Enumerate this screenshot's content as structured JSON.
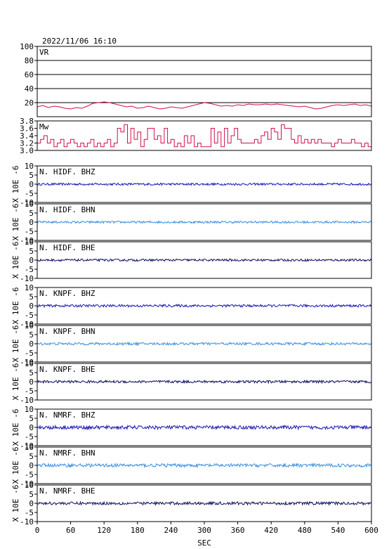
{
  "header": {
    "datetime": "2022/11/06  16:10"
  },
  "colors": {
    "vr": "#d0104a",
    "mw": "#d0104a",
    "grid": "#000000",
    "frame": "#000000"
  },
  "chart_data": {
    "type": "line",
    "x": {
      "label": "SEC",
      "ticks": [
        0,
        60,
        120,
        180,
        240,
        300,
        360,
        420,
        480,
        540,
        600
      ],
      "lim": [
        0,
        600
      ]
    },
    "panels": [
      {
        "kind": "vr",
        "label": "VR",
        "ylim": [
          0,
          100
        ],
        "yticks": [
          20,
          40,
          60,
          80,
          100
        ],
        "grid": true,
        "series": [
          {
            "x": 0,
            "y": 14
          },
          {
            "x": 10,
            "y": 16
          },
          {
            "x": 20,
            "y": 13
          },
          {
            "x": 30,
            "y": 15
          },
          {
            "x": 40,
            "y": 14
          },
          {
            "x": 50,
            "y": 12
          },
          {
            "x": 60,
            "y": 11
          },
          {
            "x": 70,
            "y": 13
          },
          {
            "x": 80,
            "y": 12
          },
          {
            "x": 90,
            "y": 15
          },
          {
            "x": 100,
            "y": 19
          },
          {
            "x": 110,
            "y": 20
          },
          {
            "x": 120,
            "y": 21
          },
          {
            "x": 130,
            "y": 20
          },
          {
            "x": 140,
            "y": 18
          },
          {
            "x": 150,
            "y": 16
          },
          {
            "x": 160,
            "y": 14
          },
          {
            "x": 170,
            "y": 15
          },
          {
            "x": 180,
            "y": 12
          },
          {
            "x": 190,
            "y": 13
          },
          {
            "x": 200,
            "y": 15
          },
          {
            "x": 210,
            "y": 13
          },
          {
            "x": 220,
            "y": 11
          },
          {
            "x": 230,
            "y": 12
          },
          {
            "x": 240,
            "y": 14
          },
          {
            "x": 250,
            "y": 13
          },
          {
            "x": 260,
            "y": 12
          },
          {
            "x": 270,
            "y": 14
          },
          {
            "x": 280,
            "y": 16
          },
          {
            "x": 290,
            "y": 18
          },
          {
            "x": 300,
            "y": 20
          },
          {
            "x": 310,
            "y": 19
          },
          {
            "x": 320,
            "y": 17
          },
          {
            "x": 330,
            "y": 15
          },
          {
            "x": 340,
            "y": 16
          },
          {
            "x": 350,
            "y": 15
          },
          {
            "x": 360,
            "y": 17
          },
          {
            "x": 370,
            "y": 16
          },
          {
            "x": 380,
            "y": 18
          },
          {
            "x": 390,
            "y": 17
          },
          {
            "x": 400,
            "y": 17
          },
          {
            "x": 410,
            "y": 18
          },
          {
            "x": 420,
            "y": 17
          },
          {
            "x": 430,
            "y": 18
          },
          {
            "x": 440,
            "y": 17
          },
          {
            "x": 450,
            "y": 16
          },
          {
            "x": 460,
            "y": 15
          },
          {
            "x": 470,
            "y": 14
          },
          {
            "x": 480,
            "y": 15
          },
          {
            "x": 490,
            "y": 13
          },
          {
            "x": 500,
            "y": 11
          },
          {
            "x": 510,
            "y": 12
          },
          {
            "x": 520,
            "y": 14
          },
          {
            "x": 530,
            "y": 16
          },
          {
            "x": 540,
            "y": 17
          },
          {
            "x": 550,
            "y": 16
          },
          {
            "x": 560,
            "y": 17
          },
          {
            "x": 570,
            "y": 18
          },
          {
            "x": 580,
            "y": 16
          },
          {
            "x": 590,
            "y": 17
          },
          {
            "x": 600,
            "y": 15
          }
        ]
      },
      {
        "kind": "mw",
        "label": "Mw",
        "ylim": [
          3.0,
          3.8
        ],
        "yticks": [
          3.0,
          3.2,
          3.4,
          3.6,
          3.8
        ],
        "grid": false,
        "series": [
          {
            "x": 0,
            "y": 3.2
          },
          {
            "x": 6,
            "y": 3.3
          },
          {
            "x": 12,
            "y": 3.4
          },
          {
            "x": 18,
            "y": 3.2
          },
          {
            "x": 24,
            "y": 3.3
          },
          {
            "x": 30,
            "y": 3.1
          },
          {
            "x": 36,
            "y": 3.2
          },
          {
            "x": 42,
            "y": 3.3
          },
          {
            "x": 48,
            "y": 3.1
          },
          {
            "x": 54,
            "y": 3.2
          },
          {
            "x": 60,
            "y": 3.3
          },
          {
            "x": 66,
            "y": 3.2
          },
          {
            "x": 72,
            "y": 3.1
          },
          {
            "x": 78,
            "y": 3.2
          },
          {
            "x": 84,
            "y": 3.1
          },
          {
            "x": 90,
            "y": 3.2
          },
          {
            "x": 96,
            "y": 3.3
          },
          {
            "x": 102,
            "y": 3.1
          },
          {
            "x": 108,
            "y": 3.2
          },
          {
            "x": 114,
            "y": 3.1
          },
          {
            "x": 120,
            "y": 3.2
          },
          {
            "x": 126,
            "y": 3.3
          },
          {
            "x": 132,
            "y": 3.1
          },
          {
            "x": 138,
            "y": 3.2
          },
          {
            "x": 144,
            "y": 3.6
          },
          {
            "x": 150,
            "y": 3.5
          },
          {
            "x": 156,
            "y": 3.7
          },
          {
            "x": 162,
            "y": 3.2
          },
          {
            "x": 168,
            "y": 3.6
          },
          {
            "x": 174,
            "y": 3.3
          },
          {
            "x": 180,
            "y": 3.5
          },
          {
            "x": 186,
            "y": 3.1
          },
          {
            "x": 192,
            "y": 3.3
          },
          {
            "x": 198,
            "y": 3.6
          },
          {
            "x": 204,
            "y": 3.6
          },
          {
            "x": 210,
            "y": 3.3
          },
          {
            "x": 216,
            "y": 3.4
          },
          {
            "x": 222,
            "y": 3.2
          },
          {
            "x": 228,
            "y": 3.6
          },
          {
            "x": 234,
            "y": 3.2
          },
          {
            "x": 240,
            "y": 3.3
          },
          {
            "x": 246,
            "y": 3.1
          },
          {
            "x": 252,
            "y": 3.2
          },
          {
            "x": 258,
            "y": 3.1
          },
          {
            "x": 264,
            "y": 3.4
          },
          {
            "x": 270,
            "y": 3.2
          },
          {
            "x": 276,
            "y": 3.4
          },
          {
            "x": 282,
            "y": 3.1
          },
          {
            "x": 288,
            "y": 3.2
          },
          {
            "x": 294,
            "y": 3.1
          },
          {
            "x": 300,
            "y": 3.1
          },
          {
            "x": 306,
            "y": 3.1
          },
          {
            "x": 312,
            "y": 3.6
          },
          {
            "x": 318,
            "y": 3.2
          },
          {
            "x": 324,
            "y": 3.5
          },
          {
            "x": 330,
            "y": 3.1
          },
          {
            "x": 336,
            "y": 3.6
          },
          {
            "x": 342,
            "y": 3.2
          },
          {
            "x": 348,
            "y": 3.4
          },
          {
            "x": 354,
            "y": 3.6
          },
          {
            "x": 360,
            "y": 3.3
          },
          {
            "x": 366,
            "y": 3.2
          },
          {
            "x": 372,
            "y": 3.2
          },
          {
            "x": 378,
            "y": 3.2
          },
          {
            "x": 384,
            "y": 3.2
          },
          {
            "x": 390,
            "y": 3.3
          },
          {
            "x": 396,
            "y": 3.2
          },
          {
            "x": 402,
            "y": 3.4
          },
          {
            "x": 408,
            "y": 3.5
          },
          {
            "x": 414,
            "y": 3.3
          },
          {
            "x": 420,
            "y": 3.6
          },
          {
            "x": 426,
            "y": 3.5
          },
          {
            "x": 432,
            "y": 3.3
          },
          {
            "x": 438,
            "y": 3.7
          },
          {
            "x": 444,
            "y": 3.6
          },
          {
            "x": 450,
            "y": 3.6
          },
          {
            "x": 456,
            "y": 3.3
          },
          {
            "x": 462,
            "y": 3.2
          },
          {
            "x": 468,
            "y": 3.4
          },
          {
            "x": 474,
            "y": 3.2
          },
          {
            "x": 480,
            "y": 3.3
          },
          {
            "x": 486,
            "y": 3.2
          },
          {
            "x": 492,
            "y": 3.3
          },
          {
            "x": 498,
            "y": 3.2
          },
          {
            "x": 504,
            "y": 3.3
          },
          {
            "x": 510,
            "y": 3.2
          },
          {
            "x": 516,
            "y": 3.2
          },
          {
            "x": 522,
            "y": 3.2
          },
          {
            "x": 528,
            "y": 3.1
          },
          {
            "x": 534,
            "y": 3.2
          },
          {
            "x": 540,
            "y": 3.3
          },
          {
            "x": 546,
            "y": 3.2
          },
          {
            "x": 552,
            "y": 3.2
          },
          {
            "x": 558,
            "y": 3.2
          },
          {
            "x": 564,
            "y": 3.3
          },
          {
            "x": 570,
            "y": 3.2
          },
          {
            "x": 576,
            "y": 3.2
          },
          {
            "x": 582,
            "y": 3.1
          },
          {
            "x": 588,
            "y": 3.2
          },
          {
            "x": 594,
            "y": 3.1
          },
          {
            "x": 600,
            "y": 3.1
          }
        ]
      },
      {
        "kind": "wave",
        "label": "N. HIDF. BHZ",
        "ylabel": "X 10E -6",
        "ylim": [
          -10,
          10
        ],
        "yticks": [
          -10,
          -5,
          0,
          5,
          10
        ],
        "color": "#1a1ab4",
        "amp": 0.6
      },
      {
        "kind": "wave",
        "label": "N. HIDF. BHN",
        "ylabel": "X 10E -6",
        "ylim": [
          -10,
          10
        ],
        "yticks": [
          -10,
          -5,
          0,
          5,
          10
        ],
        "color": "#3a8fe0",
        "amp": 0.6
      },
      {
        "kind": "wave",
        "label": "N. HIDF. BHE",
        "ylabel": "X 10E -6",
        "ylim": [
          -10,
          10
        ],
        "yticks": [
          -10,
          -5,
          0,
          5,
          10
        ],
        "color": "#101060",
        "amp": 0.6
      },
      {
        "kind": "wave",
        "label": "N. KNPF. BHZ",
        "ylabel": "X 10E -6",
        "ylim": [
          -10,
          10
        ],
        "yticks": [
          -10,
          -5,
          0,
          5,
          10
        ],
        "color": "#1a1ab4",
        "amp": 0.7
      },
      {
        "kind": "wave",
        "label": "N. KNPF. BHN",
        "ylabel": "X 10E -6",
        "ylim": [
          -10,
          10
        ],
        "yticks": [
          -10,
          -5,
          0,
          5,
          10
        ],
        "color": "#3a8fe0",
        "amp": 0.7
      },
      {
        "kind": "wave",
        "label": "N. KNPF. BHE",
        "ylabel": "X 10E -6",
        "ylim": [
          -10,
          10
        ],
        "yticks": [
          -10,
          -5,
          0,
          5,
          10
        ],
        "color": "#101060",
        "amp": 0.7
      },
      {
        "kind": "wave",
        "label": "N. NMRF. BHZ",
        "ylabel": "X 10E -6",
        "ylim": [
          -10,
          10
        ],
        "yticks": [
          -10,
          -5,
          0,
          5,
          10
        ],
        "color": "#1a1ab4",
        "amp": 1.0
      },
      {
        "kind": "wave",
        "label": "N. NMRF. BHN",
        "ylabel": "X 10E -6",
        "ylim": [
          -10,
          10
        ],
        "yticks": [
          -10,
          -5,
          0,
          5,
          10
        ],
        "color": "#3a8fe0",
        "amp": 0.9
      },
      {
        "kind": "wave",
        "label": "N. NMRF. BHE",
        "ylabel": "X 10E -6",
        "ylim": [
          -10,
          10
        ],
        "yticks": [
          -10,
          -5,
          0,
          5,
          10
        ],
        "color": "#101060",
        "amp": 0.8
      }
    ]
  }
}
